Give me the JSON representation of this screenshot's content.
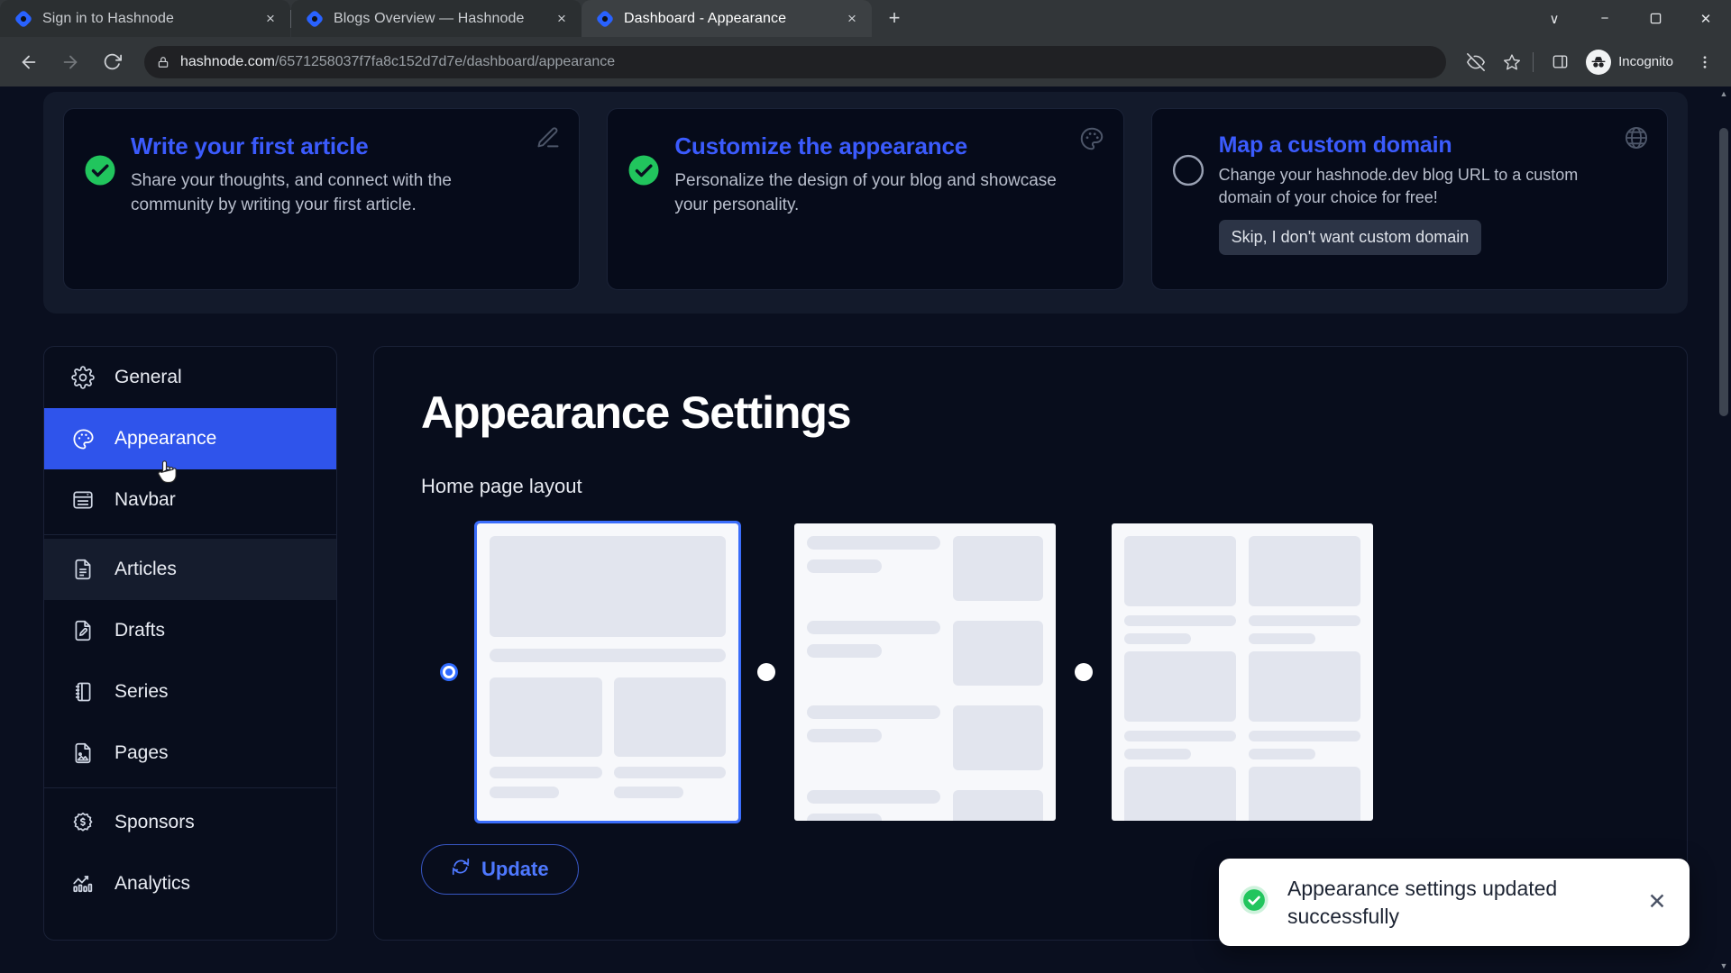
{
  "browser": {
    "tabs": [
      {
        "title": "Sign in to Hashnode",
        "active": false,
        "favicon": "hashnode-icon",
        "close_label": "×"
      },
      {
        "title": "Blogs Overview — Hashnode",
        "active": false,
        "favicon": "hashnode-icon",
        "close_label": "×"
      },
      {
        "title": "Dashboard - Appearance",
        "active": true,
        "favicon": "hashnode-icon",
        "close_label": "×"
      }
    ],
    "new_tab_label": "+",
    "window_controls": {
      "list_tabs": "∨",
      "minimize": "−",
      "maximize": "❐",
      "close": "✕"
    },
    "toolbar": {
      "back": "←",
      "forward": "→",
      "reload": "↻",
      "lock_icon": "lock-icon",
      "url_domain": "hashnode.com",
      "url_path": "/6571258037f7fa8c152d7d7e/dashboard/appearance",
      "tracking_protection_icon": "eye-off-icon",
      "bookmark_icon": "star-icon",
      "side_panel_icon": "side-panel-icon",
      "profile_label": "Incognito",
      "menu_icon": "kebab-menu-icon"
    }
  },
  "checklist": {
    "cards": [
      {
        "title": "Write your first article",
        "description": "Share your thoughts, and connect with the community by writing your first article.",
        "state": "done",
        "corner_icon": "pencil-icon"
      },
      {
        "title": "Customize the appearance",
        "description": "Personalize the design of your blog and showcase your personality.",
        "state": "done",
        "corner_icon": "palette-icon"
      },
      {
        "title": "Map a custom domain",
        "description": "Change your hashnode.dev blog URL to a custom domain of your choice for free!",
        "state": "todo",
        "corner_icon": "globe-icon",
        "skip_label": "Skip, I don't want custom domain"
      }
    ]
  },
  "sidebar": {
    "groups": [
      {
        "items": [
          {
            "label": "General",
            "icon": "gear-icon",
            "active": false,
            "hover": false
          },
          {
            "label": "Appearance",
            "icon": "palette-icon",
            "active": true,
            "hover": false
          },
          {
            "label": "Navbar",
            "icon": "navbar-icon",
            "active": false,
            "hover": false
          }
        ]
      },
      {
        "items": [
          {
            "label": "Articles",
            "icon": "document-icon",
            "active": false,
            "hover": true
          },
          {
            "label": "Drafts",
            "icon": "draft-pencil-icon",
            "active": false,
            "hover": false
          },
          {
            "label": "Series",
            "icon": "series-book-icon",
            "active": false,
            "hover": false
          },
          {
            "label": "Pages",
            "icon": "page-image-icon",
            "active": false,
            "hover": false
          }
        ]
      },
      {
        "items": [
          {
            "label": "Sponsors",
            "icon": "dollar-badge-icon",
            "active": false,
            "hover": false
          },
          {
            "label": "Analytics",
            "icon": "analytics-chart-icon",
            "active": false,
            "hover": false
          }
        ]
      }
    ]
  },
  "main": {
    "page_title": "Appearance Settings",
    "section_label": "Home page layout",
    "layouts": [
      {
        "name": "grid-layout",
        "selected": true
      },
      {
        "name": "list-layout",
        "selected": false
      },
      {
        "name": "two-column-layout",
        "selected": false
      }
    ],
    "update_button": {
      "label": "Update",
      "icon": "refresh-icon"
    }
  },
  "toast": {
    "message": "Appearance settings updated successfully",
    "icon": "check-circle-icon",
    "close_label": "✕",
    "accent": "#22c55e"
  },
  "colors": {
    "brand_blue": "#2f54eb",
    "link_blue": "#3b5bfd",
    "success_green": "#21c55d",
    "page_bg": "#0a0f1f",
    "panel_bg": "#080d1c"
  },
  "scrollbar": {
    "up_arrow": "▲",
    "down_arrow": "▼"
  }
}
